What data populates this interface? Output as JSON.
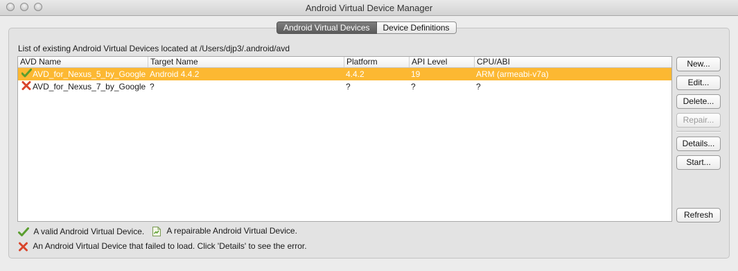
{
  "window": {
    "title": "Android Virtual Device Manager"
  },
  "tabs": [
    {
      "label": "Android Virtual Devices",
      "active": true
    },
    {
      "label": "Device Definitions",
      "active": false
    }
  ],
  "description": "List of existing Android Virtual Devices located at /Users/djp3/.android/avd",
  "table": {
    "columns": [
      "AVD Name",
      "Target Name",
      "Platform",
      "API Level",
      "CPU/ABI"
    ],
    "rows": [
      {
        "status_icon": "check-icon",
        "selected": true,
        "cells": [
          "AVD_for_Nexus_5_by_Google",
          "Android 4.4.2",
          "4.4.2",
          "19",
          "ARM (armeabi-v7a)"
        ]
      },
      {
        "status_icon": "error-x-icon",
        "selected": false,
        "cells": [
          "AVD_for_Nexus_7_by_Google",
          "?",
          "?",
          "?",
          "?"
        ]
      }
    ]
  },
  "buttons": {
    "new": "New...",
    "edit": "Edit...",
    "delete": "Delete...",
    "repair": "Repair...",
    "details": "Details...",
    "start": "Start...",
    "refresh": "Refresh"
  },
  "legend": {
    "valid": "A valid Android Virtual Device.",
    "repairable": "A repairable Android Virtual Device.",
    "failed": "An Android Virtual Device that failed to load. Click 'Details' to see the error."
  },
  "colors": {
    "selection": "#fcb832",
    "valid": "#5a9e2f",
    "error": "#d9452b"
  }
}
